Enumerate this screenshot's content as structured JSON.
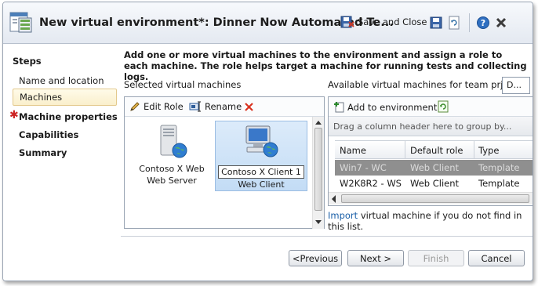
{
  "window": {
    "title": "New virtual environment*: Dinner Now Automated Te...",
    "toolbar": {
      "save_close_label": "Save and Close",
      "save_icon": "floppy-disk-icon",
      "refresh_icon": "refresh-icon",
      "help_icon": "help-icon",
      "close_icon": "close-icon"
    }
  },
  "nav": {
    "heading": "Steps",
    "items": [
      {
        "label": "Name and location"
      },
      {
        "label": "Machines",
        "selected": true
      },
      {
        "label": "Machine properties",
        "required": true
      },
      {
        "label": "Capabilities"
      },
      {
        "label": "Summary"
      }
    ],
    "required_mark": "✱"
  },
  "main": {
    "instructions": "Add one or more virtual machines to the environment and assign a role to each machine. The role helps target a machine for running tests and collecting logs.",
    "selected_label": "Selected virtual machines",
    "available_label": "Available virtual machines for team prject:",
    "team_project_value": "D...",
    "vm_toolbar": {
      "edit_role": "Edit Role",
      "rename": "Rename"
    },
    "selected_vms": [
      {
        "name": "Contoso X Web",
        "role": "Web Server",
        "icon": "server-tower-icon"
      },
      {
        "name": "Contoso X Client 1",
        "role": "Web Client",
        "icon": "client-computer-icon",
        "selected": true,
        "editing": true
      }
    ],
    "available": {
      "add_label": "Add to environment",
      "group_hint": "Drag a column header here to group by...",
      "columns": [
        "Name",
        "Default role",
        "Type"
      ],
      "rows": [
        {
          "name": "Win7 - WC",
          "role": "Web Client",
          "type": "Template",
          "selected": true
        },
        {
          "name": "W2K8R2 - WS",
          "role": "Web Client",
          "type": "Template"
        }
      ]
    },
    "import_link": "Import",
    "import_rest": "virtual machine if you do not find in this list."
  },
  "footer": {
    "previous": "<Previous",
    "next": "Next >",
    "finish": "Finish",
    "cancel": "Cancel"
  },
  "colors": {
    "accent_blue": "#1a5fa8",
    "required_red": "#cc2222",
    "selected_row": "#8f8f8f",
    "selected_tile": "#c3dcf5"
  }
}
